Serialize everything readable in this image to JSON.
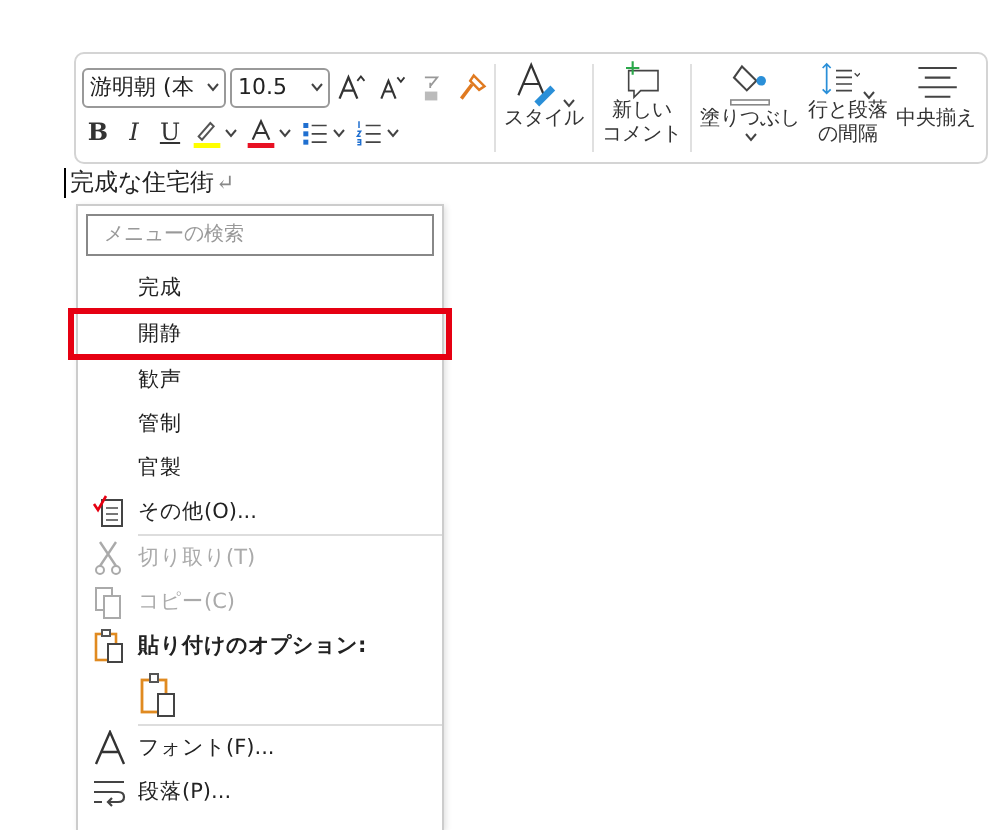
{
  "toolbar": {
    "font_name": "游明朝 (本",
    "font_size": "10.5",
    "format_buttons": [
      {
        "kind": "bold",
        "label": "B"
      },
      {
        "kind": "italic",
        "label": "I"
      },
      {
        "kind": "underline",
        "label": "U"
      }
    ],
    "large_buttons": [
      {
        "kind": "style",
        "lines": [
          "スタイル"
        ],
        "dropdown": true
      },
      {
        "kind": "comment",
        "lines": [
          "新しい",
          "コメント"
        ],
        "dropdown": false
      },
      {
        "kind": "shading",
        "lines": [
          "塗りつぶし"
        ],
        "dropdown": true
      },
      {
        "kind": "spacing",
        "lines": [
          "行と段落",
          "の間隔"
        ],
        "dropdown": true
      },
      {
        "kind": "center",
        "lines": [
          "中央揃え"
        ],
        "dropdown": false
      }
    ]
  },
  "document": {
    "text": "完成な住宅街",
    "paragraph_mark": "↵"
  },
  "menu": {
    "search_placeholder": "メニューの検索",
    "items": [
      {
        "kind": "suggestion",
        "label": "完成",
        "selected": false,
        "disabled": false
      },
      {
        "kind": "suggestion",
        "label": "開静",
        "selected": true,
        "disabled": false
      },
      {
        "kind": "suggestion",
        "label": "歓声",
        "selected": false,
        "disabled": false
      },
      {
        "kind": "suggestion",
        "label": "管制",
        "selected": false,
        "disabled": false
      },
      {
        "kind": "suggestion",
        "label": "官製",
        "selected": false,
        "disabled": false
      },
      {
        "kind": "more",
        "label": "その他(O)...",
        "selected": false,
        "disabled": false
      },
      {
        "kind": "separator"
      },
      {
        "kind": "cut",
        "label": "切り取り(T)",
        "selected": false,
        "disabled": true
      },
      {
        "kind": "copy",
        "label": "コピー(C)",
        "selected": false,
        "disabled": true
      },
      {
        "kind": "paste_header",
        "label": "貼り付けのオプション:",
        "selected": false,
        "disabled": false
      },
      {
        "kind": "paste_option",
        "selected": false,
        "disabled": false
      },
      {
        "kind": "separator"
      },
      {
        "kind": "font",
        "label": "フォント(F)...",
        "selected": false,
        "disabled": false
      },
      {
        "kind": "paragraph",
        "label": "段落(P)...",
        "selected": false,
        "disabled": false
      }
    ]
  }
}
